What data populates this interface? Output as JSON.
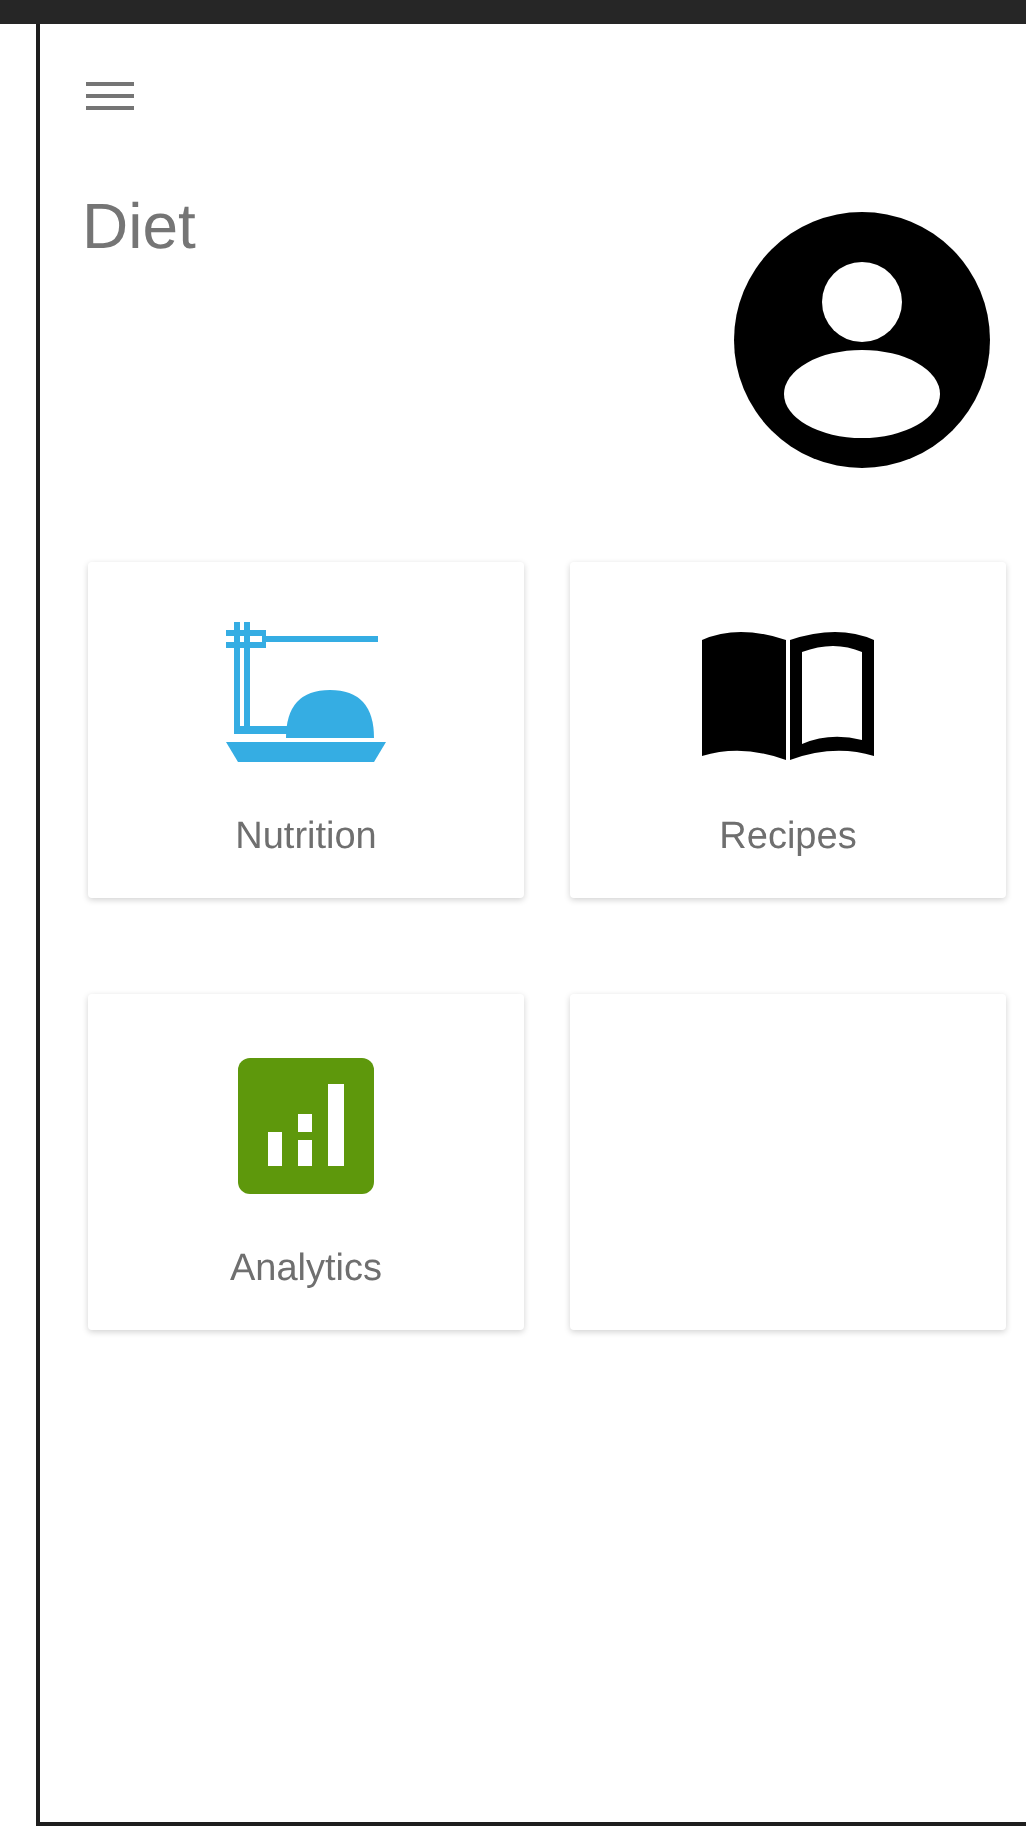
{
  "header": {
    "title": "Diet"
  },
  "tiles": [
    {
      "kind": "nutrition",
      "label": "Nutrition"
    },
    {
      "kind": "recipes",
      "label": "Recipes"
    },
    {
      "kind": "analytics",
      "label": "Analytics"
    },
    {
      "kind": "blank"
    }
  ]
}
